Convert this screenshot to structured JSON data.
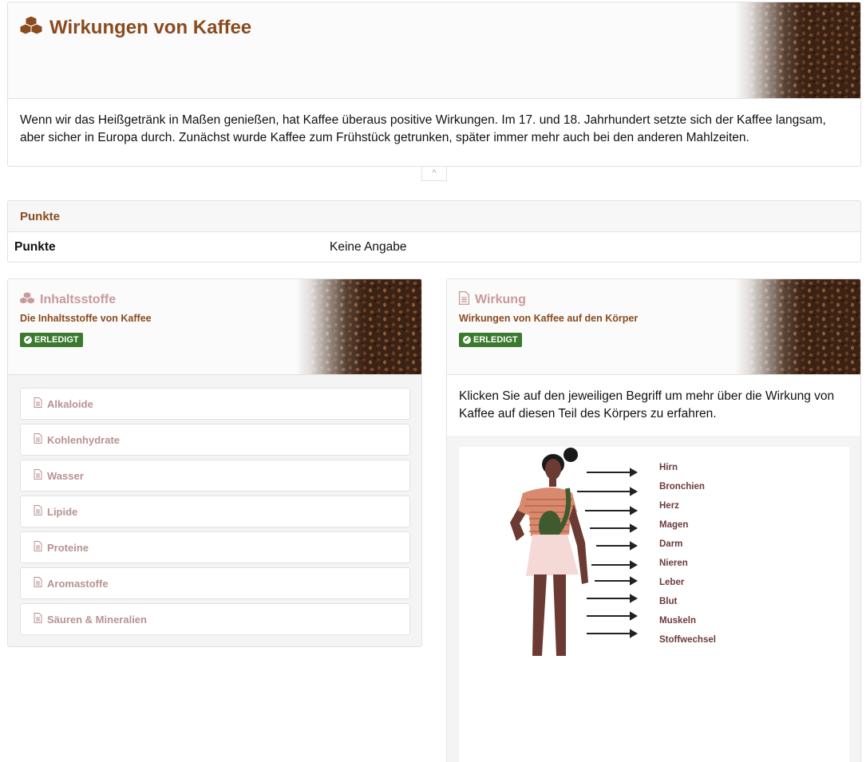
{
  "header": {
    "title": "Wirkungen von Kaffee",
    "intro": "Wenn wir das Heißgetränk in Maßen genießen, hat Kaffee überaus positive Wirkungen. Im 17. und 18. Jahrhundert setzte sich der Kaffee langsam, aber sicher in Europa durch. Zunächst wurde Kaffee zum Frühstück getrunken, später immer mehr auch bei den anderen Mahlzeiten.",
    "collapse_icon": "chevron-up-icon"
  },
  "punkte": {
    "heading": "Punkte",
    "label": "Punkte",
    "value": "Keine Angabe"
  },
  "inhaltsstoffe": {
    "title": "Inhaltsstoffe",
    "subtitle": "Die Inhaltsstoffe von Kaffee",
    "badge": "ERLEDIGT",
    "icon": "cubes-icon",
    "items": [
      {
        "label": "Alkaloide"
      },
      {
        "label": "Kohlenhydrate"
      },
      {
        "label": "Wasser"
      },
      {
        "label": "Lipide"
      },
      {
        "label": "Proteine"
      },
      {
        "label": "Aromastoffe"
      },
      {
        "label": "Säuren & Mineralien"
      }
    ]
  },
  "wirkung": {
    "title": "Wirkung",
    "subtitle": "Wirkungen von Kaffee auf den Körper",
    "badge": "ERLEDIGT",
    "icon": "document-icon",
    "description": "Klicken Sie auf den jeweiligen Begriff um mehr über die Wirkung von Kaffee auf diesen Teil des Körpers zu erfahren.",
    "body_parts": [
      "Hirn",
      "Bronchien",
      "Herz",
      "Magen",
      "Darm",
      "Nieren",
      "Leber",
      "Blut",
      "Muskeln",
      "Stoffwechsel"
    ]
  },
  "colors": {
    "accent_brown": "#8a4b1f",
    "muted_pink": "#c99a9a",
    "badge_green": "#3b7a2e"
  }
}
